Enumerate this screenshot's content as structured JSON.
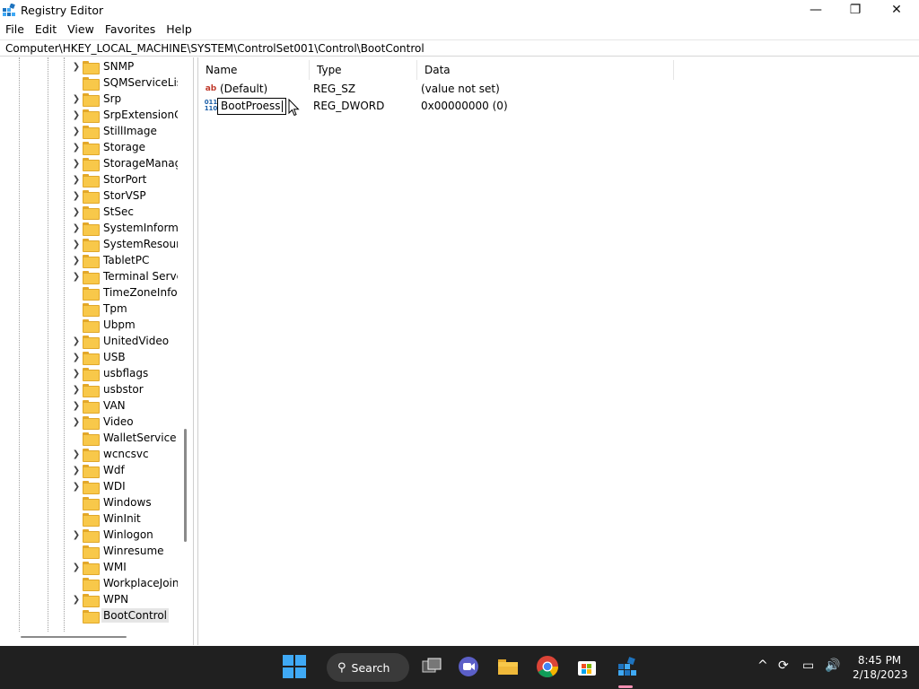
{
  "window": {
    "title": "Registry Editor",
    "minimize_glyph": "—",
    "maximize_glyph": "❐",
    "close_glyph": "✕"
  },
  "menu": [
    "File",
    "Edit",
    "View",
    "Favorites",
    "Help"
  ],
  "address": "Computer\\HKEY_LOCAL_MACHINE\\SYSTEM\\ControlSet001\\Control\\BootControl",
  "tree": {
    "items": [
      {
        "label": "SNMP",
        "expandable": true
      },
      {
        "label": "SQMServiceList",
        "expandable": false
      },
      {
        "label": "Srp",
        "expandable": true
      },
      {
        "label": "SrpExtensionCo",
        "expandable": true
      },
      {
        "label": "StillImage",
        "expandable": true
      },
      {
        "label": "Storage",
        "expandable": true
      },
      {
        "label": "StorageManage",
        "expandable": true
      },
      {
        "label": "StorPort",
        "expandable": true
      },
      {
        "label": "StorVSP",
        "expandable": true
      },
      {
        "label": "StSec",
        "expandable": true
      },
      {
        "label": "SystemInformat",
        "expandable": true
      },
      {
        "label": "SystemResource",
        "expandable": true
      },
      {
        "label": "TabletPC",
        "expandable": true
      },
      {
        "label": "Terminal Server",
        "expandable": true
      },
      {
        "label": "TimeZoneInforr",
        "expandable": false
      },
      {
        "label": "Tpm",
        "expandable": false
      },
      {
        "label": "Ubpm",
        "expandable": false
      },
      {
        "label": "UnitedVideo",
        "expandable": true
      },
      {
        "label": "USB",
        "expandable": true
      },
      {
        "label": "usbflags",
        "expandable": true
      },
      {
        "label": "usbstor",
        "expandable": true
      },
      {
        "label": "VAN",
        "expandable": true
      },
      {
        "label": "Video",
        "expandable": true
      },
      {
        "label": "WalletService",
        "expandable": false
      },
      {
        "label": "wcncsvc",
        "expandable": true
      },
      {
        "label": "Wdf",
        "expandable": true
      },
      {
        "label": "WDI",
        "expandable": true
      },
      {
        "label": "Windows",
        "expandable": false
      },
      {
        "label": "WinInit",
        "expandable": false
      },
      {
        "label": "Winlogon",
        "expandable": true
      },
      {
        "label": "Winresume",
        "expandable": false
      },
      {
        "label": "WMI",
        "expandable": true
      },
      {
        "label": "WorkplaceJoin",
        "expandable": false
      },
      {
        "label": "WPN",
        "expandable": true
      },
      {
        "label": "BootControl",
        "expandable": false,
        "selected": true
      }
    ]
  },
  "values": {
    "columns": [
      "Name",
      "Type",
      "Data"
    ],
    "rows": [
      {
        "icon": "string-value-icon",
        "icon_glyph": "ab",
        "name": "(Default)",
        "type": "REG_SZ",
        "data": "(value not set)"
      },
      {
        "icon": "binary-value-icon",
        "icon_glyph": "011 110",
        "name": "BootProess",
        "type": "REG_DWORD",
        "data": "0x00000000 (0)",
        "renaming": true
      }
    ]
  },
  "taskbar": {
    "search_label": "Search",
    "time": "8:45 PM",
    "date": "2/18/2023",
    "search_glyph": "⚲",
    "tray_up_glyph": "^",
    "tray_sync_glyph": "⟳",
    "tray_net_glyph": "▭",
    "tray_vol_glyph": "🔊"
  }
}
